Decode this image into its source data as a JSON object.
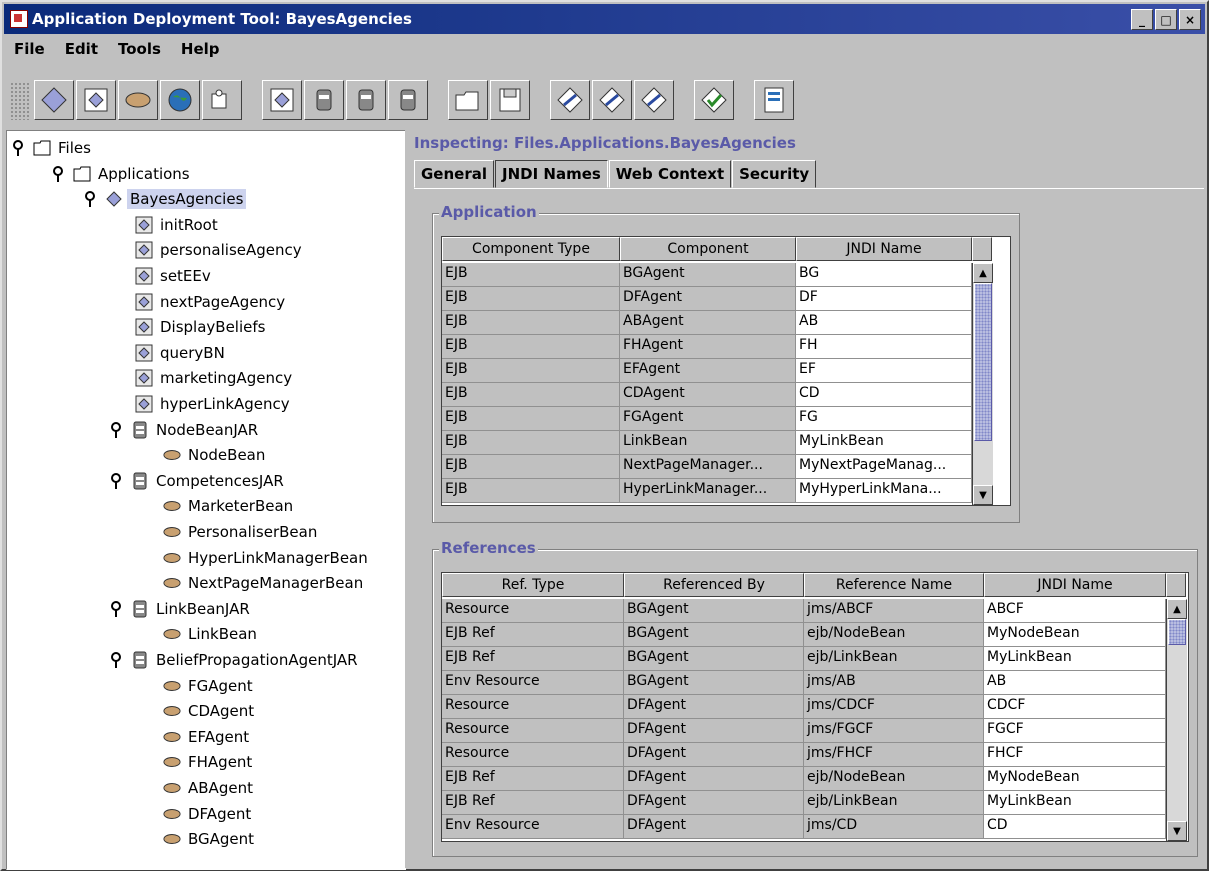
{
  "window": {
    "title": "Application Deployment Tool: BayesAgencies",
    "min": "_",
    "max": "□",
    "close": "×"
  },
  "menu": [
    "File",
    "Edit",
    "Tools",
    "Help"
  ],
  "toolbar": [
    "new-application-icon",
    "new-component-icon",
    "new-bean-icon",
    "new-web-icon",
    "new-client-icon",
    "add-diamond-icon",
    "add-jar-icon",
    "add-web-jar-icon",
    "add-client-jar-icon",
    "open-icon",
    "save-icon",
    "deploy-icon",
    "redeploy-icon",
    "undeploy-icon",
    "verify-icon",
    "server-icon"
  ],
  "tree": {
    "root": "Files",
    "applications": "Applications",
    "app": "BayesAgencies",
    "components": [
      "initRoot",
      "personaliseAgency",
      "setEEv",
      "nextPageAgency",
      "DisplayBeliefs",
      "queryBN",
      "marketingAgency",
      "hyperLinkAgency"
    ],
    "jars": [
      {
        "name": "NodeBeanJAR",
        "beans": [
          "NodeBean"
        ]
      },
      {
        "name": "CompetencesJAR",
        "beans": [
          "MarketerBean",
          "PersonaliserBean",
          "HyperLinkManagerBean",
          "NextPageManagerBean"
        ]
      },
      {
        "name": "LinkBeanJAR",
        "beans": [
          "LinkBean"
        ]
      },
      {
        "name": "BeliefPropagationAgentJAR",
        "beans": [
          "FGAgent",
          "CDAgent",
          "EFAgent",
          "FHAgent",
          "ABAgent",
          "DFAgent",
          "BGAgent"
        ]
      }
    ]
  },
  "inspecting": "Inspecting: Files.Applications.BayesAgencies",
  "tabs": [
    "General",
    "JNDI Names",
    "Web Context",
    "Security"
  ],
  "active_tab": "JNDI Names",
  "application": {
    "title": "Application",
    "columns": [
      "Component Type",
      "Component",
      "JNDI Name"
    ],
    "rows": [
      [
        "EJB",
        "BGAgent",
        "BG"
      ],
      [
        "EJB",
        "DFAgent",
        "DF"
      ],
      [
        "EJB",
        "ABAgent",
        "AB"
      ],
      [
        "EJB",
        "FHAgent",
        "FH"
      ],
      [
        "EJB",
        "EFAgent",
        "EF"
      ],
      [
        "EJB",
        "CDAgent",
        "CD"
      ],
      [
        "EJB",
        "FGAgent",
        "FG"
      ],
      [
        "EJB",
        "LinkBean",
        "MyLinkBean"
      ],
      [
        "EJB",
        "NextPageManager...",
        "MyNextPageManag..."
      ],
      [
        "EJB",
        "HyperLinkManager...",
        "MyHyperLinkMana..."
      ]
    ]
  },
  "references": {
    "title": "References",
    "columns": [
      "Ref. Type",
      "Referenced By",
      "Reference Name",
      "JNDI Name"
    ],
    "rows": [
      [
        "Resource",
        "BGAgent",
        "jms/ABCF",
        "ABCF"
      ],
      [
        "EJB Ref",
        "BGAgent",
        "ejb/NodeBean",
        "MyNodeBean"
      ],
      [
        "EJB Ref",
        "BGAgent",
        "ejb/LinkBean",
        "MyLinkBean"
      ],
      [
        "Env Resource",
        "BGAgent",
        "jms/AB",
        "AB"
      ],
      [
        "Resource",
        "DFAgent",
        "jms/CDCF",
        "CDCF"
      ],
      [
        "Resource",
        "DFAgent",
        "jms/FGCF",
        "FGCF"
      ],
      [
        "Resource",
        "DFAgent",
        "jms/FHCF",
        "FHCF"
      ],
      [
        "EJB Ref",
        "DFAgent",
        "ejb/NodeBean",
        "MyNodeBean"
      ],
      [
        "EJB Ref",
        "DFAgent",
        "ejb/LinkBean",
        "MyLinkBean"
      ],
      [
        "Env Resource",
        "DFAgent",
        "jms/CD",
        "CD"
      ]
    ]
  }
}
